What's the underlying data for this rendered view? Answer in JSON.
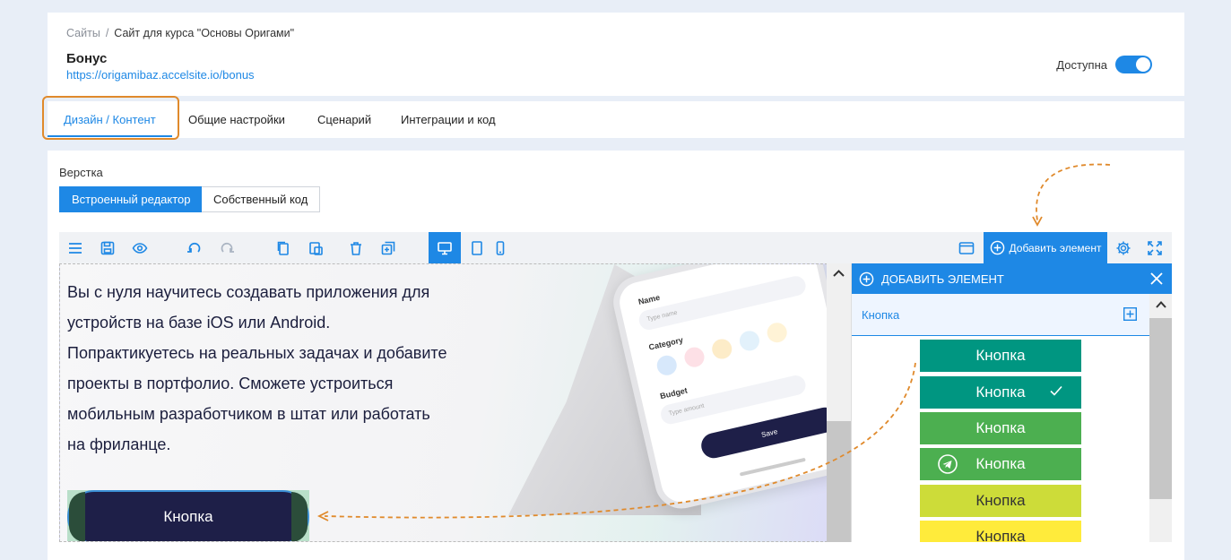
{
  "header": {
    "breadcrumb": {
      "root": "Сайты",
      "separator": "/",
      "current": "Сайт для курса \"Основы Оригами\""
    },
    "title": "Бонус",
    "url": "https://origamibaz.accelsite.io/bonus",
    "availability_label": "Доступна",
    "availability_on": true
  },
  "tabs": [
    {
      "label": "Дизайн / Контент",
      "active": true
    },
    {
      "label": "Общие настройки",
      "active": false
    },
    {
      "label": "Сценарий",
      "active": false
    },
    {
      "label": "Интеграции и код",
      "active": false
    }
  ],
  "layout_section": {
    "label": "Верстка",
    "modes": [
      {
        "label": "Встроенный редактор",
        "active": true
      },
      {
        "label": "Собственный код",
        "active": false
      }
    ]
  },
  "toolbar": {
    "icons": [
      "menu-icon",
      "save-icon",
      "eye-icon",
      "undo-icon",
      "redo-icon",
      "copy-icon",
      "paste-icon",
      "trash-icon",
      "duplicate-icon",
      "desktop-icon",
      "tablet-icon",
      "mobile-icon",
      "window-icon",
      "settings-icon",
      "fullscreen-icon"
    ],
    "add_element_label": "Добавить элемент"
  },
  "canvas": {
    "text_lines": [
      "Вы с нуля научитесь создавать приложения для",
      "устройств на базе iOS или Android.",
      "Попрактикуетесь на реальных задачах и добавите",
      "проекты в портфолио. Сможете устроиться",
      "мобильным разработчиком в штат или работать",
      "на фриланце."
    ],
    "button_label": "Кнопка",
    "phone": {
      "name_label": "Name",
      "name_placeholder": "Type name",
      "category_label": "Category",
      "budget_label": "Budget",
      "amount_placeholder": "Type amount",
      "save_label": "Save"
    }
  },
  "add_panel": {
    "title": "ДОБАВИТЬ ЭЛЕМЕНТ",
    "category": "Кнопка",
    "presets": [
      {
        "label": "Кнопка",
        "bg": "#009681",
        "color": "#ffffff",
        "icon": ""
      },
      {
        "label": "Кнопка",
        "bg": "#009681",
        "color": "#ffffff",
        "icon": "check-icon"
      },
      {
        "label": "Кнопка",
        "bg": "#4caf50",
        "color": "#ffffff",
        "icon": ""
      },
      {
        "label": "Кнопка",
        "bg": "#4caf50",
        "color": "#ffffff",
        "icon": "telegram-icon"
      },
      {
        "label": "Кнопка",
        "bg": "#cddc39",
        "color": "#333333",
        "icon": ""
      },
      {
        "label": "Кнопка",
        "bg": "#ffeb3b",
        "color": "#333333",
        "icon": ""
      }
    ]
  },
  "colors": {
    "accent": "#1e88e5",
    "highlight": "#e08a2c",
    "canvas_button": "#1e1f48"
  }
}
